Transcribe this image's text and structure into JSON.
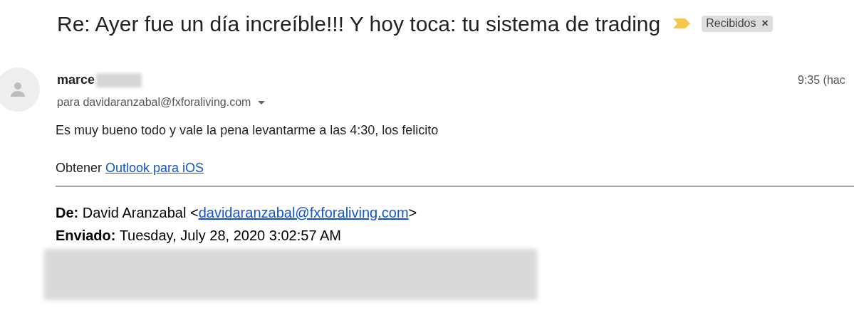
{
  "subject": "Re: Ayer fue un día increíble!!! Y hoy toca: tu sistema de trading",
  "important": true,
  "label": {
    "text": "Recibidos",
    "close": "×"
  },
  "sender": {
    "name": "marce",
    "redacted": true
  },
  "recipient": "para davidaranzabal@fxforaliving.com",
  "time": "9:35 (hac",
  "body": "Es muy bueno todo y vale la pena levantarme a las 4:30, los felicito",
  "signature": {
    "text": "Obtener ",
    "link": "Outlook para iOS"
  },
  "quoted_header": [
    {
      "label": "De:",
      "text": "David Aranzabal <",
      "link": "davidaranzabal@fxforaliving.com",
      "after": ">"
    },
    {
      "label": "Enviado:",
      "text": "Tuesday, July 28, 2020 3:02:57 AM"
    }
  ],
  "quoted_redacted": true
}
